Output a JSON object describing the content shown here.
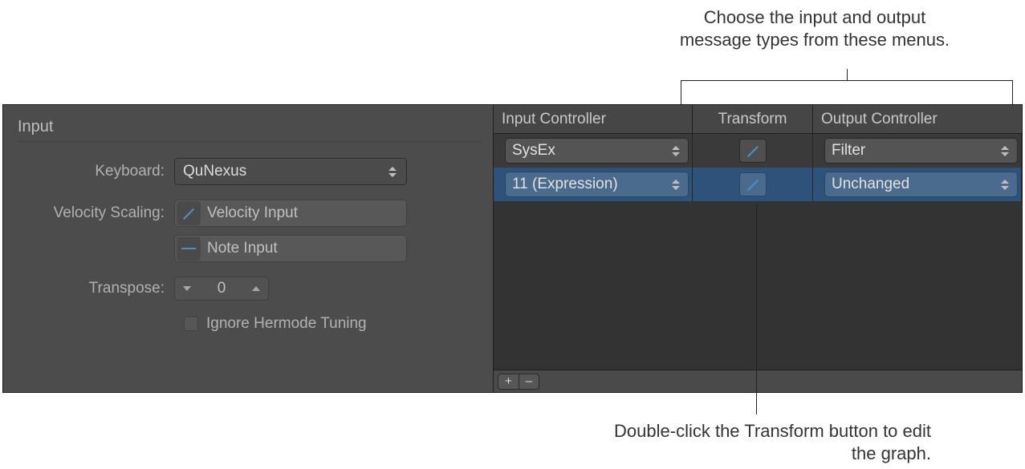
{
  "callouts": {
    "top": "Choose the input and output message types from these menus.",
    "bottom": "Double-click the Transform button to edit the graph."
  },
  "input_panel": {
    "title": "Input",
    "keyboard_label": "Keyboard:",
    "keyboard_value": "QuNexus",
    "velocity_scaling_label": "Velocity Scaling:",
    "velocity_scaling_value": "Velocity Input",
    "note_input_value": "Note Input",
    "transpose_label": "Transpose:",
    "transpose_value": "0",
    "ignore_hermode_label": "Ignore Hermode Tuning"
  },
  "controller_table": {
    "headers": {
      "input": "Input Controller",
      "transform": "Transform",
      "output": "Output Controller"
    },
    "rows": [
      {
        "input": "SysEx",
        "output": "Filter"
      },
      {
        "input": "11 (Expression)",
        "output": "Unchanged"
      }
    ],
    "footer": {
      "plus": "+",
      "minus": "–"
    }
  }
}
